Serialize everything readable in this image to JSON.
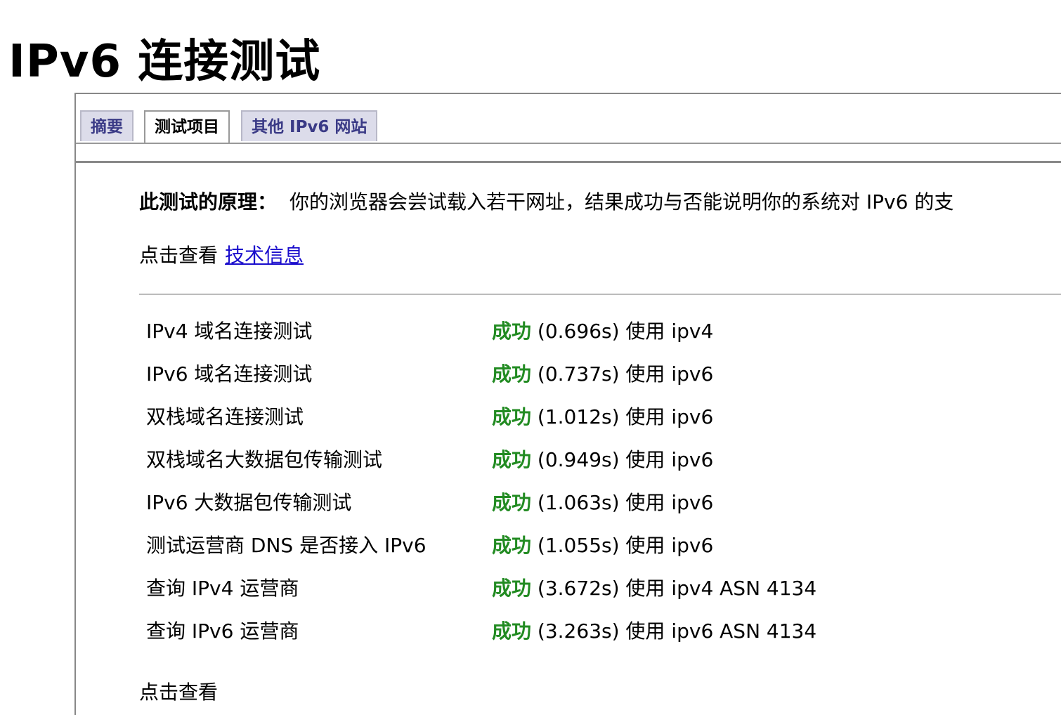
{
  "page": {
    "title": "IPv6 连接测试"
  },
  "tabs": [
    {
      "label": "摘要",
      "active": false
    },
    {
      "label": "测试项目",
      "active": true
    },
    {
      "label": "其他 IPv6 网站",
      "active": false
    }
  ],
  "principle": {
    "label": "此测试的原理：",
    "text": "你的浏览器会尝试载入若干网址，结果成功与否能说明你的系统对 IPv6 的支"
  },
  "techinfo": {
    "prefix": "点击查看",
    "link_text": "技术信息"
  },
  "colors": {
    "success": "#228b22",
    "link": "#1a0dcc",
    "tab_inactive_bg": "#dcdcea",
    "tab_inactive_text": "#3a3a86"
  },
  "results": [
    {
      "name": "IPv4 域名连接测试",
      "status": "成功",
      "detail": "(0.696s) 使用 ipv4"
    },
    {
      "name": "IPv6 域名连接测试",
      "status": "成功",
      "detail": "(0.737s) 使用 ipv6"
    },
    {
      "name": "双栈域名连接测试",
      "status": "成功",
      "detail": "(1.012s) 使用 ipv6"
    },
    {
      "name": "双栈域名大数据包传输测试",
      "status": "成功",
      "detail": "(0.949s) 使用 ipv6"
    },
    {
      "name": "IPv6 大数据包传输测试",
      "status": "成功",
      "detail": "(1.063s) 使用 ipv6"
    },
    {
      "name": "测试运营商 DNS 是否接入 IPv6",
      "status": "成功",
      "detail": "(1.055s) 使用 ipv6"
    },
    {
      "name": "查询 IPv4 运营商",
      "status": "成功",
      "detail": "(3.672s) 使用 ipv4 ASN 4134"
    },
    {
      "name": "查询 IPv6 运营商",
      "status": "成功",
      "detail": "(3.263s) 使用 ipv6 ASN 4134"
    }
  ],
  "footer": {
    "text": "点击查看"
  }
}
